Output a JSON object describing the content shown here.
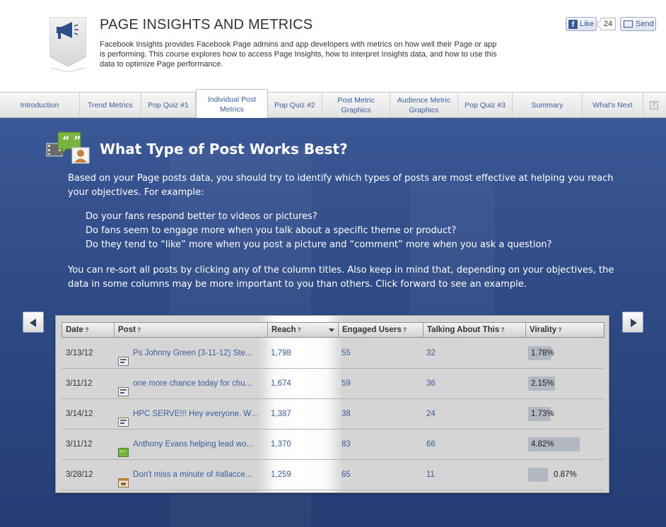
{
  "header": {
    "title": "PAGE INSIGHTS AND METRICS",
    "description": "Facebook Insights provides Facebook Page admins and app developers with metrics on how well their Page or app is performing. This course explores how to access Page Insights, how to interpret Insights data, and how to use this data to optimize Page performance.",
    "like_label": "Like",
    "like_count": "24",
    "send_label": "Send",
    "logo_icon": "megaphone-icon"
  },
  "tabs": [
    {
      "label": "Introduction",
      "active": false
    },
    {
      "label": "Trend Metrics",
      "active": false
    },
    {
      "label": "Pop Quiz #1",
      "active": false
    },
    {
      "label": "Individual Post Metrics",
      "active": true
    },
    {
      "label": "Pop Quiz #2",
      "active": false
    },
    {
      "label": "Post Metric Graphics",
      "active": false
    },
    {
      "label": "Audience Metric Graphics",
      "active": false
    },
    {
      "label": "Pop Quiz #3",
      "active": false
    },
    {
      "label": "Summary",
      "active": false
    },
    {
      "label": "What's Next",
      "active": false
    }
  ],
  "help_label": "?",
  "section": {
    "title": "What Type of Post Works Best?",
    "intro": "Based on your Page posts data, you should try to identify which types of posts are most effective at helping you reach your objectives. For example:",
    "questions": [
      "Do your fans respond better to videos or pictures?",
      "Do fans seem to engage more when you talk about a specific theme or product?",
      "Do they tend to “like” more when you post a picture and “comment” more when you ask a question?"
    ],
    "outro": "You can re-sort all posts by clicking any of the column titles. Also keep in mind that, depending on your objectives, the data in some columns may be more important to you than others. Click forward to see an example."
  },
  "table": {
    "help_mark": "?",
    "columns": [
      "Date",
      "Post",
      "Reach",
      "Engaged Users",
      "Talking About This",
      "Virality"
    ],
    "sorted_column": "Reach",
    "rows": [
      {
        "date": "3/13/12",
        "post": "Ps Johnny Green (3-11-12) Ste...",
        "post_icon": "status-update-icon",
        "reach": "1,798",
        "engaged": "55",
        "talking": "32",
        "virality": "1.78%",
        "virality_value": 1.78
      },
      {
        "date": "3/11/12",
        "post": "one more chance today for chu...",
        "post_icon": "status-update-icon",
        "reach": "1,674",
        "engaged": "59",
        "talking": "36",
        "virality": "2.15%",
        "virality_value": 2.15
      },
      {
        "date": "3/14/12",
        "post": "HPC SERVE!!! Hey everyone, We ...",
        "post_icon": "status-update-icon",
        "reach": "1,387",
        "engaged": "38",
        "talking": "24",
        "virality": "1.73%",
        "virality_value": 1.73
      },
      {
        "date": "3/11/12",
        "post": "Anthony Evans helping lead wo...",
        "post_icon": "question-icon",
        "reach": "1,370",
        "engaged": "83",
        "talking": "66",
        "virality": "4.82%",
        "virality_value": 4.82
      },
      {
        "date": "3/28/12",
        "post": "Don't miss a minute of #allacce...",
        "post_icon": "event-icon",
        "reach": "1,259",
        "engaged": "65",
        "talking": "11",
        "virality": "0.87%",
        "virality_value": 0.87
      }
    ]
  },
  "colors": {
    "main_bg": "#2f4d8a",
    "link": "#3b5d9a",
    "virality_bar": "#b3b9c2"
  }
}
